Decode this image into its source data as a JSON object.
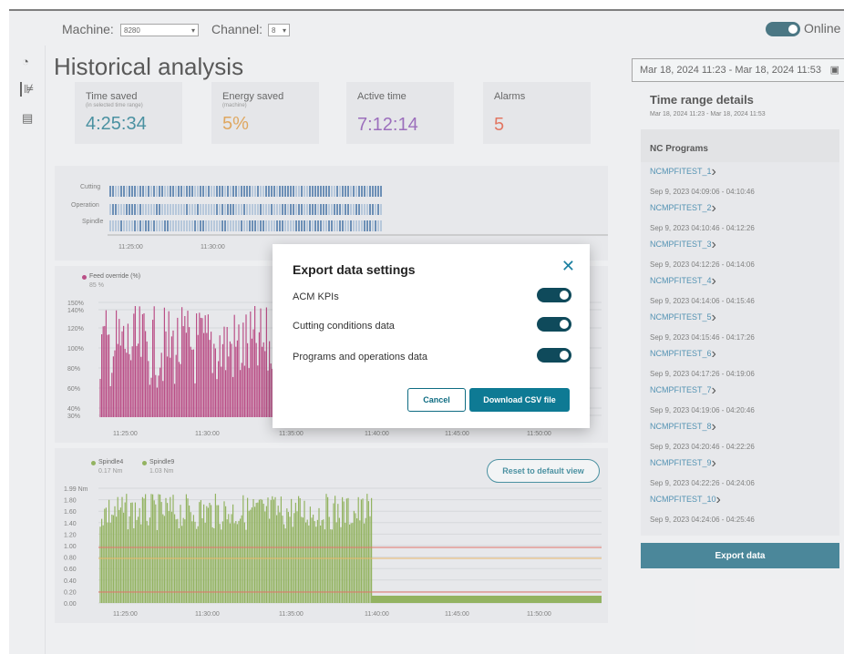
{
  "topbar": {
    "machine_label": "Machine:",
    "machine_value": "8280",
    "channel_label": "Channel:",
    "channel_value": "8",
    "online_label": "Online"
  },
  "page": {
    "title": "Historical analysis"
  },
  "kpis": [
    {
      "label": "Time saved",
      "sub": "(in selected time range)",
      "value": "4:25:34",
      "color": "#0e6c82"
    },
    {
      "label": "Energy saved",
      "sub": "(machine)",
      "value": "5%",
      "color": "#d58a2b"
    },
    {
      "label": "Active time",
      "sub": "",
      "value": "7:12:14",
      "color": "#7b3fa6"
    },
    {
      "label": "Alarms",
      "sub": "",
      "value": "5",
      "color": "#d84a2f"
    }
  ],
  "timeline": {
    "rows": [
      "Cutting",
      "Operation",
      "Spindle"
    ],
    "ticks": [
      "11:25:00",
      "11:30:00"
    ]
  },
  "feed_chart": {
    "legend_name": "Feed override (%)",
    "legend_value": "85 %",
    "y_ticks": [
      "150%",
      "140%",
      "120%",
      "100%",
      "80%",
      "60%",
      "40%",
      "30%"
    ],
    "x_ticks": [
      "11:25:00",
      "11:30:00",
      "11:35:00",
      "11:40:00",
      "11:45:00",
      "11:50:00"
    ],
    "color": "#a3155f"
  },
  "spindle_chart": {
    "legend": [
      {
        "name": "Spindle4",
        "value": "0.17 Nm"
      },
      {
        "name": "Spindle9",
        "value": "1.03 Nm"
      }
    ],
    "reset_label": "Reset to default view",
    "y_ticks": [
      "1.99 Nm",
      "1.80",
      "1.60",
      "1.40",
      "1.20",
      "1.00",
      "0.80",
      "0.60",
      "0.40",
      "0.20",
      "0.00"
    ],
    "x_ticks": [
      "11:25:00",
      "11:30:00",
      "11:35:00",
      "11:40:00",
      "11:45:00",
      "11:50:00"
    ],
    "color": "#6f9a2c"
  },
  "modal": {
    "title": "Export data settings",
    "options": [
      {
        "label": "ACM KPIs",
        "on": true
      },
      {
        "label": "Cutting conditions data",
        "on": true
      },
      {
        "label": "Programs and operations data",
        "on": true
      }
    ],
    "cancel_label": "Cancel",
    "download_label": "Download CSV file"
  },
  "right": {
    "date_range": "Mar 18, 2024 11:23 - Mar 18, 2024 11:53",
    "details_title": "Time range details",
    "details_sub": "Mar 18, 2024 11:23 - Mar 18, 2024 11:53",
    "nc_title": "NC Programs",
    "programs": [
      {
        "name": "NCMPFITEST_1",
        "time": "Sep 9, 2023 04:09:06 - 04:10:46"
      },
      {
        "name": "NCMPFITEST_2",
        "time": "Sep 9, 2023 04:10:46 - 04:12:26"
      },
      {
        "name": "NCMPFITEST_3",
        "time": "Sep 9, 2023 04:12:26 - 04:14:06"
      },
      {
        "name": "NCMPFITEST_4",
        "time": "Sep 9, 2023 04:14:06 - 04:15:46"
      },
      {
        "name": "NCMPFITEST_5",
        "time": "Sep 9, 2023 04:15:46 - 04:17:26"
      },
      {
        "name": "NCMPFITEST_6",
        "time": "Sep 9, 2023 04:17:26 - 04:19:06"
      },
      {
        "name": "NCMPFITEST_7",
        "time": "Sep 9, 2023 04:19:06 - 04:20:46"
      },
      {
        "name": "NCMPFITEST_8",
        "time": "Sep 9, 2023 04:20:46 - 04:22:26"
      },
      {
        "name": "NCMPFITEST_9",
        "time": "Sep 9, 2023 04:22:26 - 04:24:06"
      },
      {
        "name": "NCMPFITEST_10",
        "time": "Sep 9, 2023 04:24:06 - 04:25:46"
      }
    ],
    "export_label": "Export data"
  }
}
